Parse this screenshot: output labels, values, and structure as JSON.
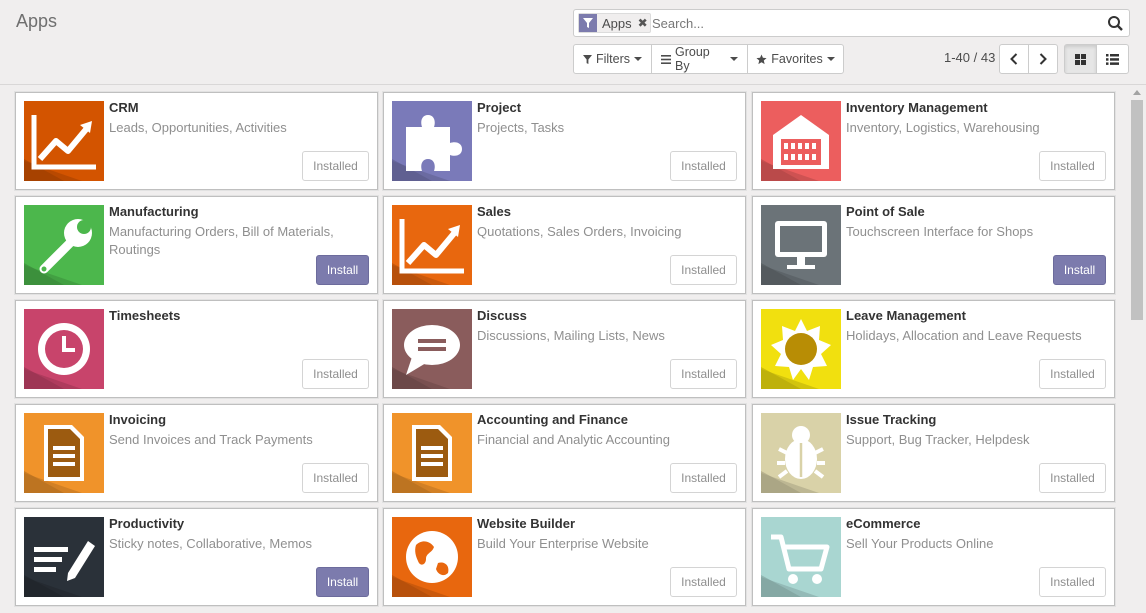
{
  "breadcrumb": "Apps",
  "search": {
    "facet_label": "Apps",
    "placeholder": "Search..."
  },
  "filters": {
    "filters_label": "Filters",
    "groupby_label": "Group By",
    "favorites_label": "Favorites"
  },
  "pager": {
    "value": "1-40 / 43"
  },
  "colors": {
    "accent": "#7c7bad"
  },
  "apps": [
    {
      "name": "CRM",
      "summary": "Leads, Opportunities, Activities",
      "action": "Installed",
      "color": "#d35400",
      "icon": "chart-line-icon"
    },
    {
      "name": "Project",
      "summary": "Projects, Tasks",
      "action": "Installed",
      "color": "#7a7ab9",
      "icon": "puzzle-piece-icon"
    },
    {
      "name": "Inventory Management",
      "summary": "Inventory, Logistics, Warehousing",
      "action": "Installed",
      "color": "#ec5e5e",
      "icon": "warehouse-icon"
    },
    {
      "name": "Manufacturing",
      "summary": "Manufacturing Orders, Bill of Materials, Routings",
      "action": "Install",
      "color": "#4cb74c",
      "icon": "wrench-icon"
    },
    {
      "name": "Sales",
      "summary": "Quotations, Sales Orders, Invoicing",
      "action": "Installed",
      "color": "#e8670e",
      "icon": "chart-line-icon"
    },
    {
      "name": "Point of Sale",
      "summary": "Touchscreen Interface for Shops",
      "action": "Install",
      "color": "#6b7378",
      "icon": "monitor-icon"
    },
    {
      "name": "Timesheets",
      "summary": "",
      "action": "Installed",
      "color": "#c8446b",
      "icon": "clock-icon"
    },
    {
      "name": "Discuss",
      "summary": "Discussions, Mailing Lists, News",
      "action": "Installed",
      "color": "#8a5c5c",
      "icon": "speech-bubble-icon"
    },
    {
      "name": "Leave Management",
      "summary": "Holidays, Allocation and Leave Requests",
      "action": "Installed",
      "color": "#f1e00f",
      "icon": "sun-icon"
    },
    {
      "name": "Invoicing",
      "summary": "Send Invoices and Track Payments",
      "action": "Installed",
      "color": "#f0932a",
      "icon": "document-icon"
    },
    {
      "name": "Accounting and Finance",
      "summary": "Financial and Analytic Accounting",
      "action": "Installed",
      "color": "#f0932a",
      "icon": "document-icon"
    },
    {
      "name": "Issue Tracking",
      "summary": "Support, Bug Tracker, Helpdesk",
      "action": "Installed",
      "color": "#d9d2a8",
      "icon": "bug-icon"
    },
    {
      "name": "Productivity",
      "summary": "Sticky notes, Collaborative, Memos",
      "action": "Install",
      "color": "#2a3139",
      "icon": "note-pencil-icon"
    },
    {
      "name": "Website Builder",
      "summary": "Build Your Enterprise Website",
      "action": "Installed",
      "color": "#e8670e",
      "icon": "globe-icon"
    },
    {
      "name": "eCommerce",
      "summary": "Sell Your Products Online",
      "action": "Installed",
      "color": "#a9d6d1",
      "icon": "shopping-cart-icon"
    }
  ]
}
